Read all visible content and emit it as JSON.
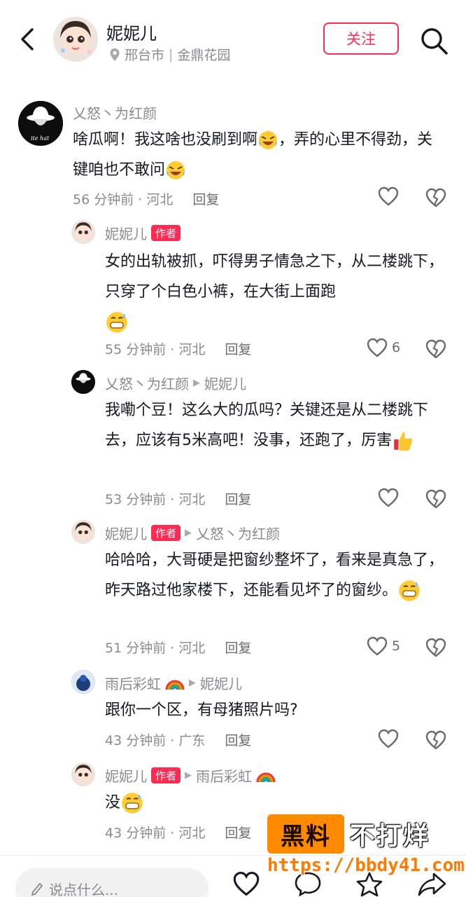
{
  "header": {
    "name": "妮妮儿",
    "location_city": "邢台市",
    "location_place": "金鼎花园",
    "follow_label": "关注"
  },
  "comments": [
    {
      "user": "乂怒丶为红颜",
      "text": "啥瓜啊！我这啥也没刷到啊",
      "text2": "，弄的心里不得劲，关键咱也不敢问",
      "time_loc": "56 分钟前 · 河北",
      "reply": "回复",
      "likes": ""
    },
    {
      "user": "妮妮儿",
      "badge": "作者",
      "text": "女的出轨被抓，吓得男子情急之下，从二楼跳下，只穿了个白色小裤，在大街上面跑",
      "time_loc": "55 分钟前 · 河北",
      "reply": "回复",
      "likes": "6"
    },
    {
      "user": "乂怒丶为红颜",
      "reply_to": "妮妮儿",
      "text": "我嘞个豆！这么大的瓜吗？关键还是从二楼跳下去，应该有5米高吧！没事，还跑了，厉害",
      "time_loc": "53 分钟前 · 河北",
      "reply": "回复",
      "likes": ""
    },
    {
      "user": "妮妮儿",
      "badge": "作者",
      "reply_to": "乂怒丶为红颜",
      "text": "哈哈哈，大哥硬是把窗纱整坏了，看来是真急了，昨天路过他家楼下，还能看见坏了的窗纱。",
      "time_loc": "51 分钟前 · 河北",
      "reply": "回复",
      "likes": "5"
    },
    {
      "user": "雨后彩虹",
      "reply_to": "妮妮儿",
      "text": "跟你一个区，有母猪照片吗?",
      "time_loc": "43 分钟前 · 广东",
      "reply": "回复",
      "likes": ""
    },
    {
      "user": "妮妮儿",
      "badge": "作者",
      "reply_to": "雨后彩虹",
      "text": "没",
      "time_loc": "43 分钟前 · 河北",
      "reply": "回复",
      "likes": ""
    }
  ],
  "bottom": {
    "input_placeholder": "说点什么..."
  },
  "watermark": {
    "box_text": "黑料",
    "right_text": "不打烊",
    "url": "https://bbdy41.com"
  },
  "colors": {
    "accent": "#fe2c55",
    "meta_gray": "#8a8b91",
    "text": "#161823"
  }
}
